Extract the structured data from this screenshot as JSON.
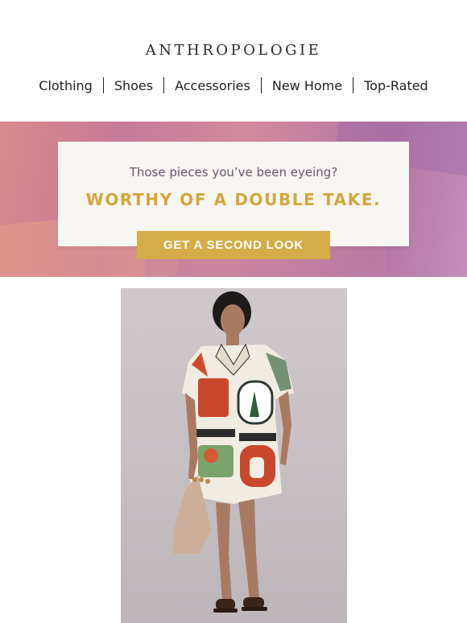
{
  "brand": {
    "name": "ANTHROPOLOGIE"
  },
  "nav": {
    "items": [
      "Clothing",
      "Shoes",
      "Accessories",
      "New Home",
      "Top-Rated"
    ]
  },
  "banner": {
    "subtitle": "Those pieces you’ve been eyeing?",
    "headline": "WORTHY OF A DOUBLE TAKE.",
    "cta_label": "GET A SECOND LOOK"
  },
  "colors": {
    "gold": "#d5ac47",
    "plum": "#6e5470",
    "banner_pink": "#c7799a"
  },
  "product": {
    "image_icon": "model-in-printed-shirt-dress-photo"
  }
}
